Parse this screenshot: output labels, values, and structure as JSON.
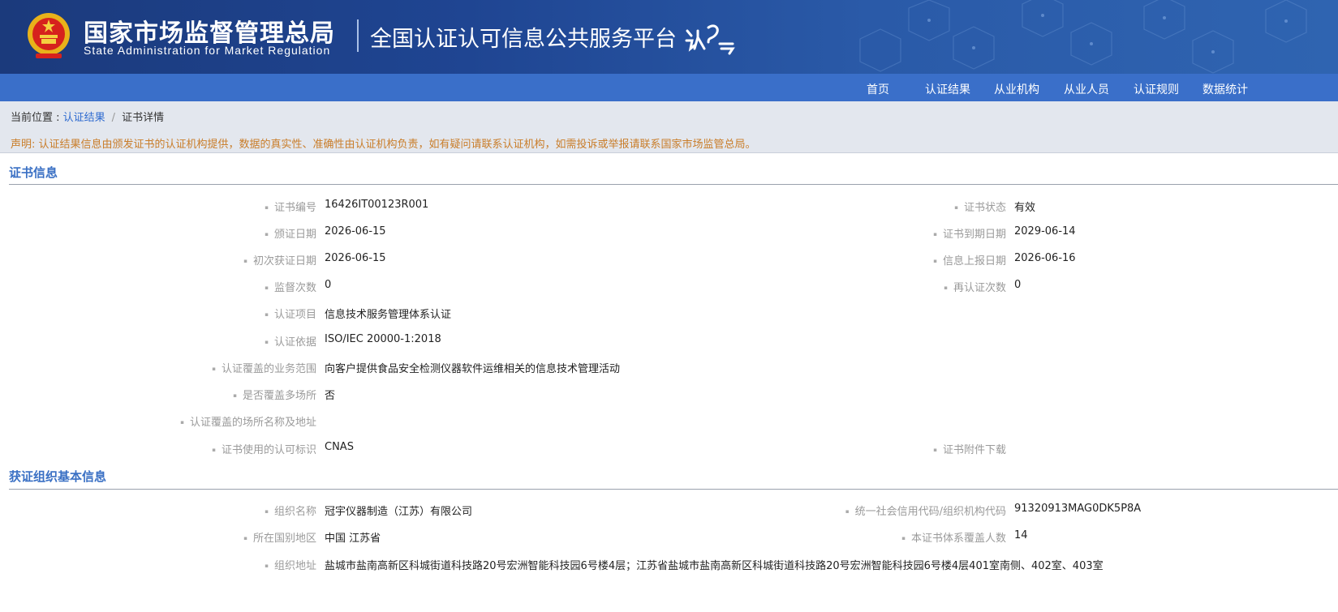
{
  "header": {
    "agency_cn": "国家市场监督管理总局",
    "agency_en": "State Administration  for  Market Regulation",
    "platform_title": "全国认证认可信息公共服务平台",
    "logo_icon": "emblem-icon",
    "platform_logo_icon": "renzheng-cloud-logo-icon"
  },
  "nav": {
    "items": [
      "首页",
      "认证结果",
      "从业机构",
      "从业人员",
      "认证规则",
      "数据统计"
    ]
  },
  "breadcrumb": {
    "prefix": "当前位置 : ",
    "link": "认证结果",
    "separator": "/",
    "current": "证书详情"
  },
  "notice": "声明: 认证结果信息由颁发证书的认证机构提供，数据的真实性、准确性由认证机构负责，如有疑问请联系认证机构，如需投诉或举报请联系国家市场监管总局。",
  "cert_section": {
    "title": "证书信息",
    "fields": {
      "cert_no": {
        "label": "证书编号",
        "value": "16426IT00123R001"
      },
      "cert_status": {
        "label": "证书状态",
        "value": "有效"
      },
      "issue_date": {
        "label": "颁证日期",
        "value": "2026-06-15"
      },
      "expiry_date": {
        "label": "证书到期日期",
        "value": "2029-06-14"
      },
      "first_date": {
        "label": "初次获证日期",
        "value": "2026-06-15"
      },
      "report_date": {
        "label": "信息上报日期",
        "value": "2026-06-16"
      },
      "supervision_count": {
        "label": "监督次数",
        "value": "0"
      },
      "recert_count": {
        "label": "再认证次数",
        "value": "0"
      },
      "cert_project": {
        "label": "认证项目",
        "value": "信息技术服务管理体系认证"
      },
      "cert_basis": {
        "label": "认证依据",
        "value": "ISO/IEC 20000-1:2018"
      },
      "scope": {
        "label": "认证覆盖的业务范围",
        "value": "向客户提供食品安全检测仪器软件运维相关的信息技术管理活动"
      },
      "multi_site": {
        "label": "是否覆盖多场所",
        "value": "否"
      },
      "sites": {
        "label": "认证覆盖的场所名称及地址",
        "value": ""
      },
      "accreditation_mark": {
        "label": "证书使用的认可标识",
        "value": "CNAS"
      },
      "attachment": {
        "label": "证书附件下载",
        "value": ""
      }
    }
  },
  "org_section": {
    "title": "获证组织基本信息",
    "fields": {
      "org_name": {
        "label": "组织名称",
        "value": "冠宇仪器制造（江苏）有限公司"
      },
      "credit_code": {
        "label": "统一社会信用代码/组织机构代码",
        "value": "91320913MAG0DK5P8A"
      },
      "region": {
        "label": "所在国别地区",
        "value": "中国 江苏省"
      },
      "headcount": {
        "label": "本证书体系覆盖人数",
        "value": "14"
      },
      "address": {
        "label": "组织地址",
        "value": "盐城市盐南高新区科城街道科技路20号宏洲智能科技园6号楼4层；江苏省盐城市盐南高新区科城街道科技路20号宏洲智能科技园6号楼4层401室南侧、402室、403室"
      }
    }
  }
}
